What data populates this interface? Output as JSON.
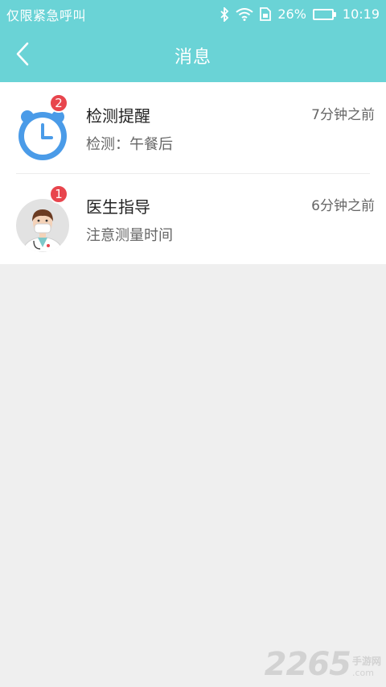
{
  "status_bar": {
    "carrier": "仅限紧急呼叫",
    "battery_percent": "26%",
    "battery_level": 0.26,
    "time": "10:19",
    "icons": [
      "bluetooth-icon",
      "wifi-icon",
      "sim-icon",
      "battery-icon"
    ]
  },
  "header": {
    "title": "消息",
    "back_icon": "chevron-left-icon",
    "background_color": "#6ad3d6"
  },
  "messages": [
    {
      "title": "检测提醒",
      "subtitle": "检测：午餐后",
      "time": "7分钟之前",
      "badge": "2",
      "icon": "alarm-clock-icon"
    },
    {
      "title": "医生指导",
      "subtitle": "注意测量时间",
      "time": "6分钟之前",
      "badge": "1",
      "icon": "doctor-avatar-icon"
    }
  ],
  "watermark": {
    "number": "2265",
    "text": "手游网",
    "domain": ".com"
  },
  "colors": {
    "accent": "#6ad3d6",
    "badge": "#e8454d",
    "clock_blue": "#4a9be8"
  }
}
